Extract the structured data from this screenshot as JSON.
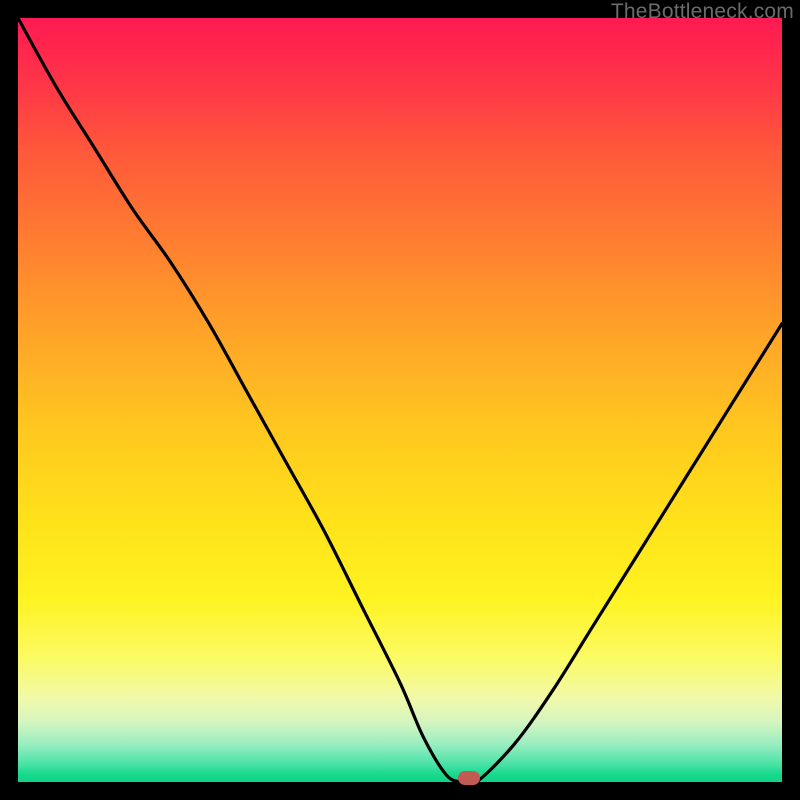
{
  "watermark": "TheBottleneck.com",
  "colors": {
    "frame": "#000000",
    "curve": "#000000",
    "marker": "#c05a52",
    "gradient_top": "#ff1a52",
    "gradient_bottom": "#0fd488"
  },
  "chart_data": {
    "type": "line",
    "title": "",
    "xlabel": "",
    "ylabel": "",
    "xlim": [
      0,
      100
    ],
    "ylim": [
      0,
      100
    ],
    "x": [
      0,
      5,
      10,
      15,
      20,
      25,
      30,
      35,
      40,
      45,
      50,
      53,
      56,
      58,
      60,
      65,
      70,
      75,
      80,
      85,
      90,
      95,
      100
    ],
    "values": [
      100,
      91,
      83,
      75,
      68,
      60,
      51,
      42,
      33,
      23,
      13,
      6,
      1,
      0,
      0,
      5,
      12,
      20,
      28,
      36,
      44,
      52,
      60
    ],
    "marker": {
      "x": 59,
      "y": 0
    },
    "grid": false,
    "legend": false
  }
}
